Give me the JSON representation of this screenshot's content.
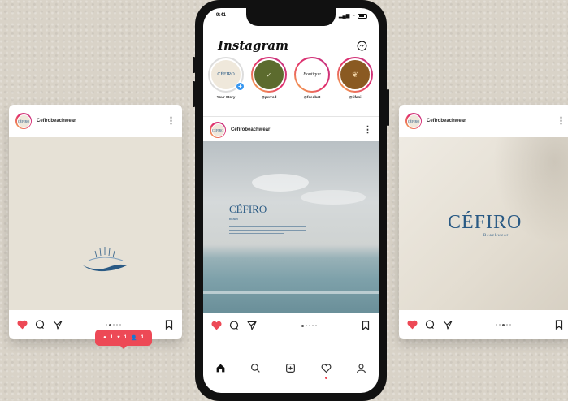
{
  "left_post": {
    "username": "Cefirobeachwear",
    "avatar_text": "CÉFIRO"
  },
  "phone": {
    "status_time": "9:41",
    "app_name": "Instagram",
    "stories": [
      {
        "label": "Your Story",
        "inner": "CÉFIRO",
        "color": "#efe8db",
        "text_color": "#2a5a84"
      },
      {
        "label": "@perrod",
        "inner": "",
        "color": "#5c6b2e",
        "text_color": "#fff"
      },
      {
        "label": "@feedbot",
        "inner": "Boutique",
        "color": "#ffffff",
        "text_color": "#222"
      },
      {
        "label": "@tifani",
        "inner": "",
        "color": "#8a5a22",
        "text_color": "#fff"
      }
    ],
    "post": {
      "username": "Cefirobeachwear",
      "brand": "CÉFIRO",
      "subtitle": "beach"
    },
    "notification": {
      "comments": "1",
      "likes": "1",
      "follows": "1"
    }
  },
  "right_post": {
    "username": "Cefirobeachwear",
    "brand": "CÉFIRO",
    "tagline": "Beachwear"
  },
  "colors": {
    "accent": "#ed4956",
    "brand_blue": "#2a5a84",
    "card_bg": "#e6e1d6"
  }
}
